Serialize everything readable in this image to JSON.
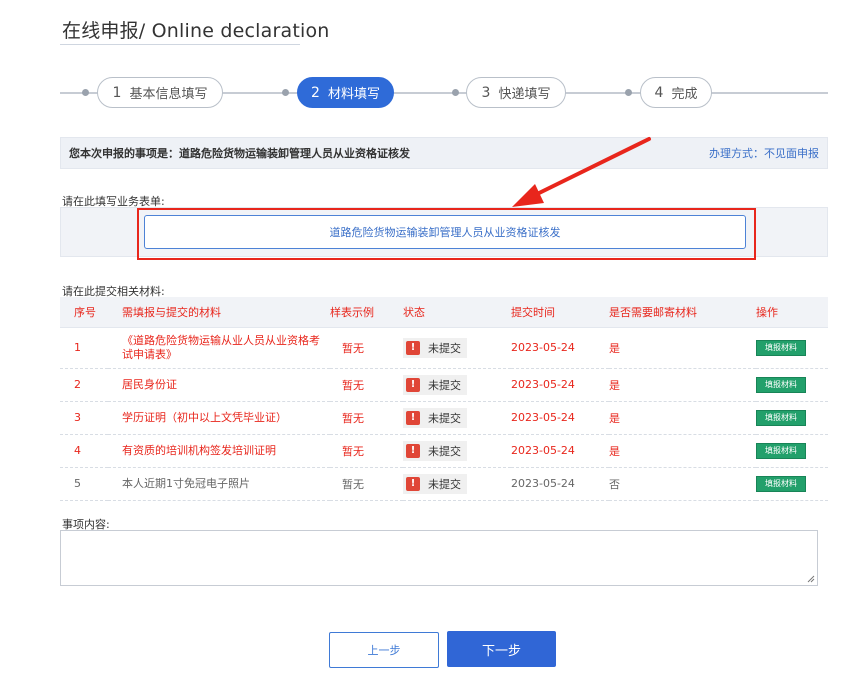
{
  "header": {
    "title": "在线申报/ Online declaration"
  },
  "stepper": {
    "steps": [
      {
        "num": "1",
        "label": "基本信息填写"
      },
      {
        "num": "2",
        "label": "材料填写"
      },
      {
        "num": "3",
        "label": "快递填写"
      },
      {
        "num": "4",
        "label": "完成"
      }
    ],
    "active_index": 1
  },
  "info": {
    "item_text": "您本次申报的事项是：道路危险货物运输装卸管理人员从业资格证核发",
    "method_text": "办理方式：不见面申报"
  },
  "form_section": {
    "label": "请在此填写业务表单:",
    "form_button_label": "道路危险货物运输装卸管理人员从业资格证核发"
  },
  "materials": {
    "label": "请在此提交相关材料:",
    "headers": [
      "序号",
      "需填报与提交的材料",
      "样表示例",
      "状态",
      "提交时间",
      "是否需要邮寄材料",
      "操作"
    ],
    "rows": [
      {
        "idx": "1",
        "material": "《道路危险货物运输从业人员从业资格考试申请表》",
        "sample": "暂无",
        "status": "未提交",
        "time": "2023-05-24",
        "mail": "是",
        "action": "填报材料"
      },
      {
        "idx": "2",
        "material": "居民身份证",
        "sample": "暂无",
        "status": "未提交",
        "time": "2023-05-24",
        "mail": "是",
        "action": "填报材料"
      },
      {
        "idx": "3",
        "material": "学历证明（初中以上文凭毕业证）",
        "sample": "暂无",
        "status": "未提交",
        "time": "2023-05-24",
        "mail": "是",
        "action": "填报材料"
      },
      {
        "idx": "4",
        "material": "有资质的培训机构签发培训证明",
        "sample": "暂无",
        "status": "未提交",
        "time": "2023-05-24",
        "mail": "是",
        "action": "填报材料"
      },
      {
        "idx": "5",
        "material": "本人近期1寸免冠电子照片",
        "sample": "暂无",
        "status": "未提交",
        "time": "2023-05-24",
        "mail": "否",
        "action": "填报材料"
      }
    ]
  },
  "content": {
    "label": "事项内容:",
    "value": ""
  },
  "buttons": {
    "prev": "上一步",
    "next": "下一步"
  },
  "colors": {
    "accent": "#2f6bd8",
    "required_red": "#e8261c",
    "action_green": "#22a06b"
  }
}
